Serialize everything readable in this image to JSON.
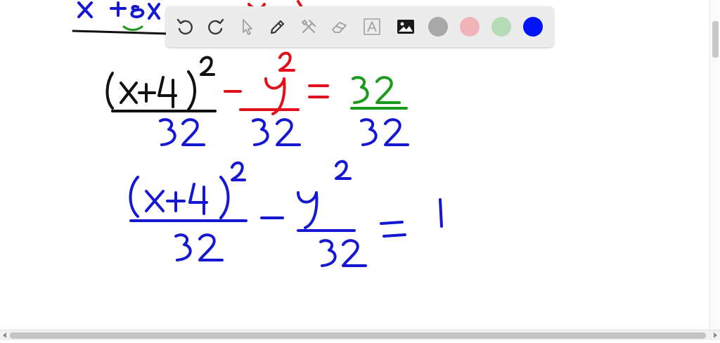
{
  "toolbar": {
    "tools": [
      {
        "name": "undo-icon",
        "enabled": true
      },
      {
        "name": "redo-icon",
        "enabled": true
      },
      {
        "name": "select-pointer-icon",
        "enabled": false
      },
      {
        "name": "pen-icon",
        "enabled": true
      },
      {
        "name": "tools-icon",
        "enabled": false
      },
      {
        "name": "eraser-icon",
        "enabled": false
      },
      {
        "name": "text-icon",
        "enabled": false
      },
      {
        "name": "image-icon",
        "enabled": true
      }
    ],
    "colors": [
      {
        "name": "gray",
        "hex": "#a8a8a8"
      },
      {
        "name": "pink",
        "hex": "#f0b4b8"
      },
      {
        "name": "green",
        "hex": "#b5dcb5"
      },
      {
        "name": "blue",
        "hex": "#0014f5"
      }
    ],
    "icon_color": "#3a3a3a",
    "icon_disabled_color": "#a0a0a0"
  },
  "ink_colors": {
    "black": "#111111",
    "red": "#e0101c",
    "green": "#1b9a1b",
    "blue": "#1518d0"
  }
}
